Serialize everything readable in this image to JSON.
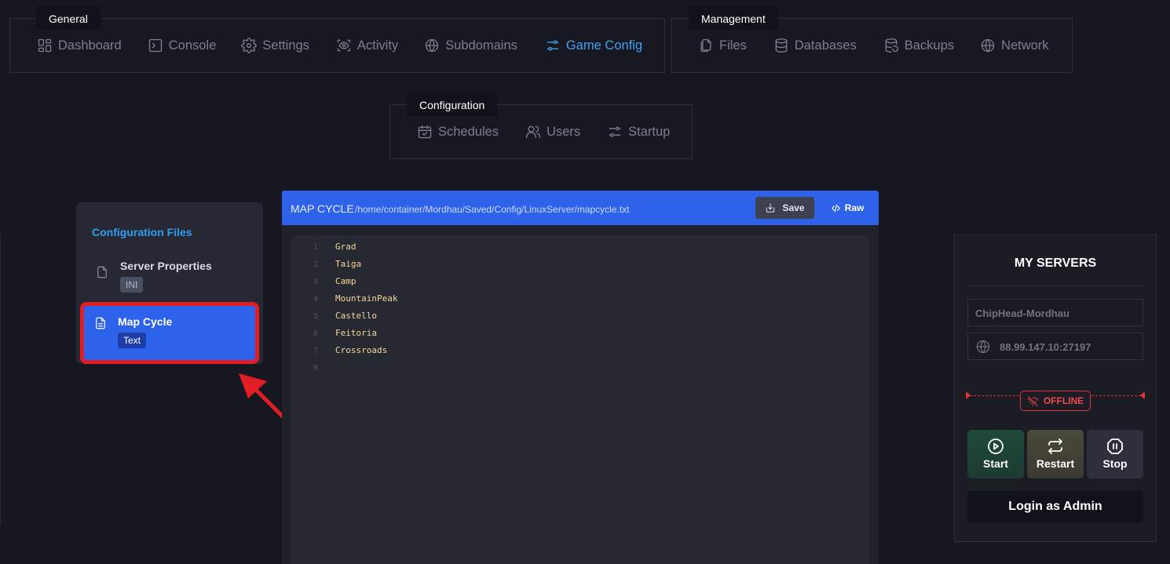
{
  "nav": {
    "general": {
      "legend": "General",
      "items": [
        {
          "label": "Dashboard",
          "icon": "dashboard-icon"
        },
        {
          "label": "Console",
          "icon": "terminal-icon"
        },
        {
          "label": "Settings",
          "icon": "gear-icon"
        },
        {
          "label": "Activity",
          "icon": "activity-eye-icon"
        },
        {
          "label": "Subdomains",
          "icon": "globe-icon"
        },
        {
          "label": "Game Config",
          "icon": "sliders-icon",
          "active": true
        }
      ]
    },
    "management": {
      "legend": "Management",
      "items": [
        {
          "label": "Files",
          "icon": "files-icon"
        },
        {
          "label": "Databases",
          "icon": "database-icon"
        },
        {
          "label": "Backups",
          "icon": "backup-icon"
        },
        {
          "label": "Network",
          "icon": "globe-icon"
        }
      ]
    },
    "configuration": {
      "legend": "Configuration",
      "items": [
        {
          "label": "Schedules",
          "icon": "calendar-icon"
        },
        {
          "label": "Users",
          "icon": "users-icon"
        },
        {
          "label": "Startup",
          "icon": "sliders-icon"
        }
      ]
    }
  },
  "sidebar": {
    "title": "Configuration Files",
    "files": [
      {
        "name": "Server Properties",
        "badge": "INI"
      },
      {
        "name": "Map Cycle",
        "badge": "Text",
        "selected": true
      }
    ]
  },
  "editor": {
    "title": "MAP CYCLE",
    "path": "/home/container/Mordhau/Saved/Config/LinuxServer/mapcycle.txt",
    "save_label": "Save",
    "raw_label": "Raw",
    "lines": [
      "Grad",
      "Taiga",
      "Camp",
      "MountainPeak",
      "Castello",
      "Feitoria",
      "Crossroads",
      ""
    ]
  },
  "servers": {
    "title": "MY SERVERS",
    "name": "ChipHead-Mordhau",
    "address": "88.99.147.10:27197",
    "status": "OFFLINE",
    "buttons": {
      "start": "Start",
      "restart": "Restart",
      "stop": "Stop"
    },
    "login_label": "Login as Admin"
  },
  "colors": {
    "accent": "#3ea3f4",
    "editor_header": "#2e62ea",
    "offline": "#f0494f",
    "highlight_box": "#e21e25"
  }
}
